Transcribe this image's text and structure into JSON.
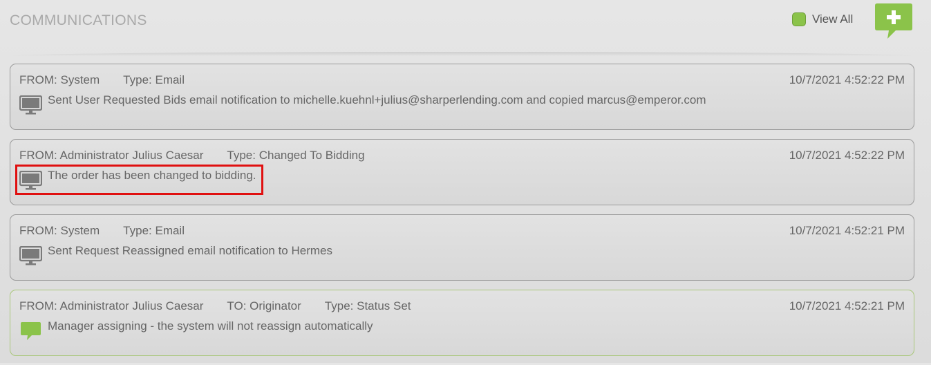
{
  "header": {
    "title": "COMMUNICATIONS",
    "view_all_label": "View All",
    "add_button_icon": "plus-speech-bubble-icon"
  },
  "communications": [
    {
      "from": "FROM: System",
      "to": "",
      "type": "Type: Email",
      "date": "10/7/2021 4:52:22 PM",
      "icon": "monitor-icon",
      "message": "Sent User Requested Bids email notification to michelle.kuehnl+julius@sharperlending.com and copied marcus@emperor.com"
    },
    {
      "from": "FROM: Administrator Julius Caesar",
      "to": "",
      "type": "Type: Changed To Bidding",
      "date": "10/7/2021 4:52:22 PM",
      "icon": "monitor-icon",
      "message": "The order has been changed to bidding."
    },
    {
      "from": "FROM: System",
      "to": "",
      "type": "Type: Email",
      "date": "10/7/2021 4:52:21 PM",
      "icon": "monitor-icon",
      "message": "Sent Request Reassigned email notification to Hermes"
    },
    {
      "from": "FROM: Administrator Julius Caesar",
      "to": "TO: Originator",
      "type": "Type: Status Set",
      "date": "10/7/2021 4:52:21 PM",
      "icon": "speech-bubble-icon",
      "message": "Manager assigning - the system will not reassign automatically"
    }
  ],
  "colors": {
    "accent_green": "#8bc34a",
    "highlight_red": "#e01010"
  }
}
